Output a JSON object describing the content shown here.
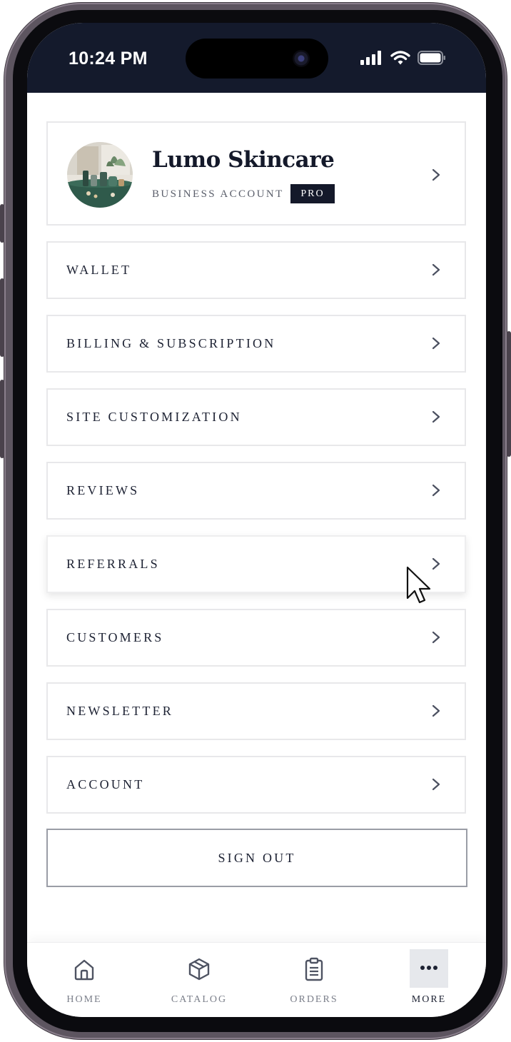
{
  "status_bar": {
    "time": "10:24 PM"
  },
  "profile": {
    "name": "Lumo Skincare",
    "account_type": "BUSINESS ACCOUNT",
    "badge": "PRO"
  },
  "menu": {
    "items": [
      {
        "label": "WALLET"
      },
      {
        "label": "BILLING & SUBSCRIPTION"
      },
      {
        "label": "SITE CUSTOMIZATION"
      },
      {
        "label": "REVIEWS"
      },
      {
        "label": "REFERRALS"
      },
      {
        "label": "CUSTOMERS"
      },
      {
        "label": "NEWSLETTER"
      },
      {
        "label": "ACCOUNT"
      }
    ],
    "sign_out": "SIGN OUT"
  },
  "tabbar": {
    "tabs": [
      {
        "label": "HOME",
        "icon": "home-icon"
      },
      {
        "label": "CATALOG",
        "icon": "box-icon"
      },
      {
        "label": "ORDERS",
        "icon": "clipboard-icon"
      },
      {
        "label": "MORE",
        "icon": "more-icon",
        "active": true
      }
    ]
  },
  "colors": {
    "status_bar_bg": "#141a2c",
    "text_primary": "#1d2233",
    "badge_bg": "#14192a"
  }
}
